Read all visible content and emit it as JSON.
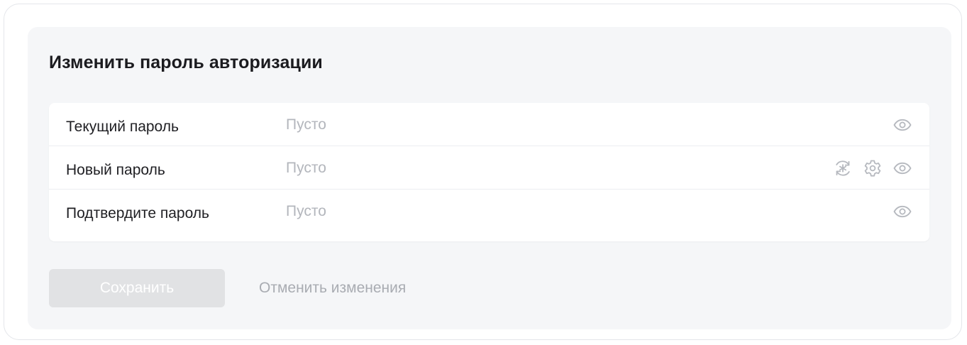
{
  "title": "Изменить пароль авторизации",
  "fields": [
    {
      "label": "Текущий пароль",
      "placeholder": "Пусто",
      "value": ""
    },
    {
      "label": "Новый пароль",
      "placeholder": "Пусто",
      "value": ""
    },
    {
      "label": "Подтвердите пароль",
      "placeholder": "Пусто",
      "value": ""
    }
  ],
  "icons": {
    "visibility": "eye-icon",
    "generate": "generate-password-icon",
    "settings": "gear-icon",
    "color": "#b6b9bf"
  },
  "actions": {
    "save_label": "Сохранить",
    "cancel_label": "Отменить изменения"
  },
  "colors": {
    "panel_bg": "#f5f6f8",
    "save_disabled_bg": "#e1e2e4",
    "muted_text": "#a9acb2"
  }
}
